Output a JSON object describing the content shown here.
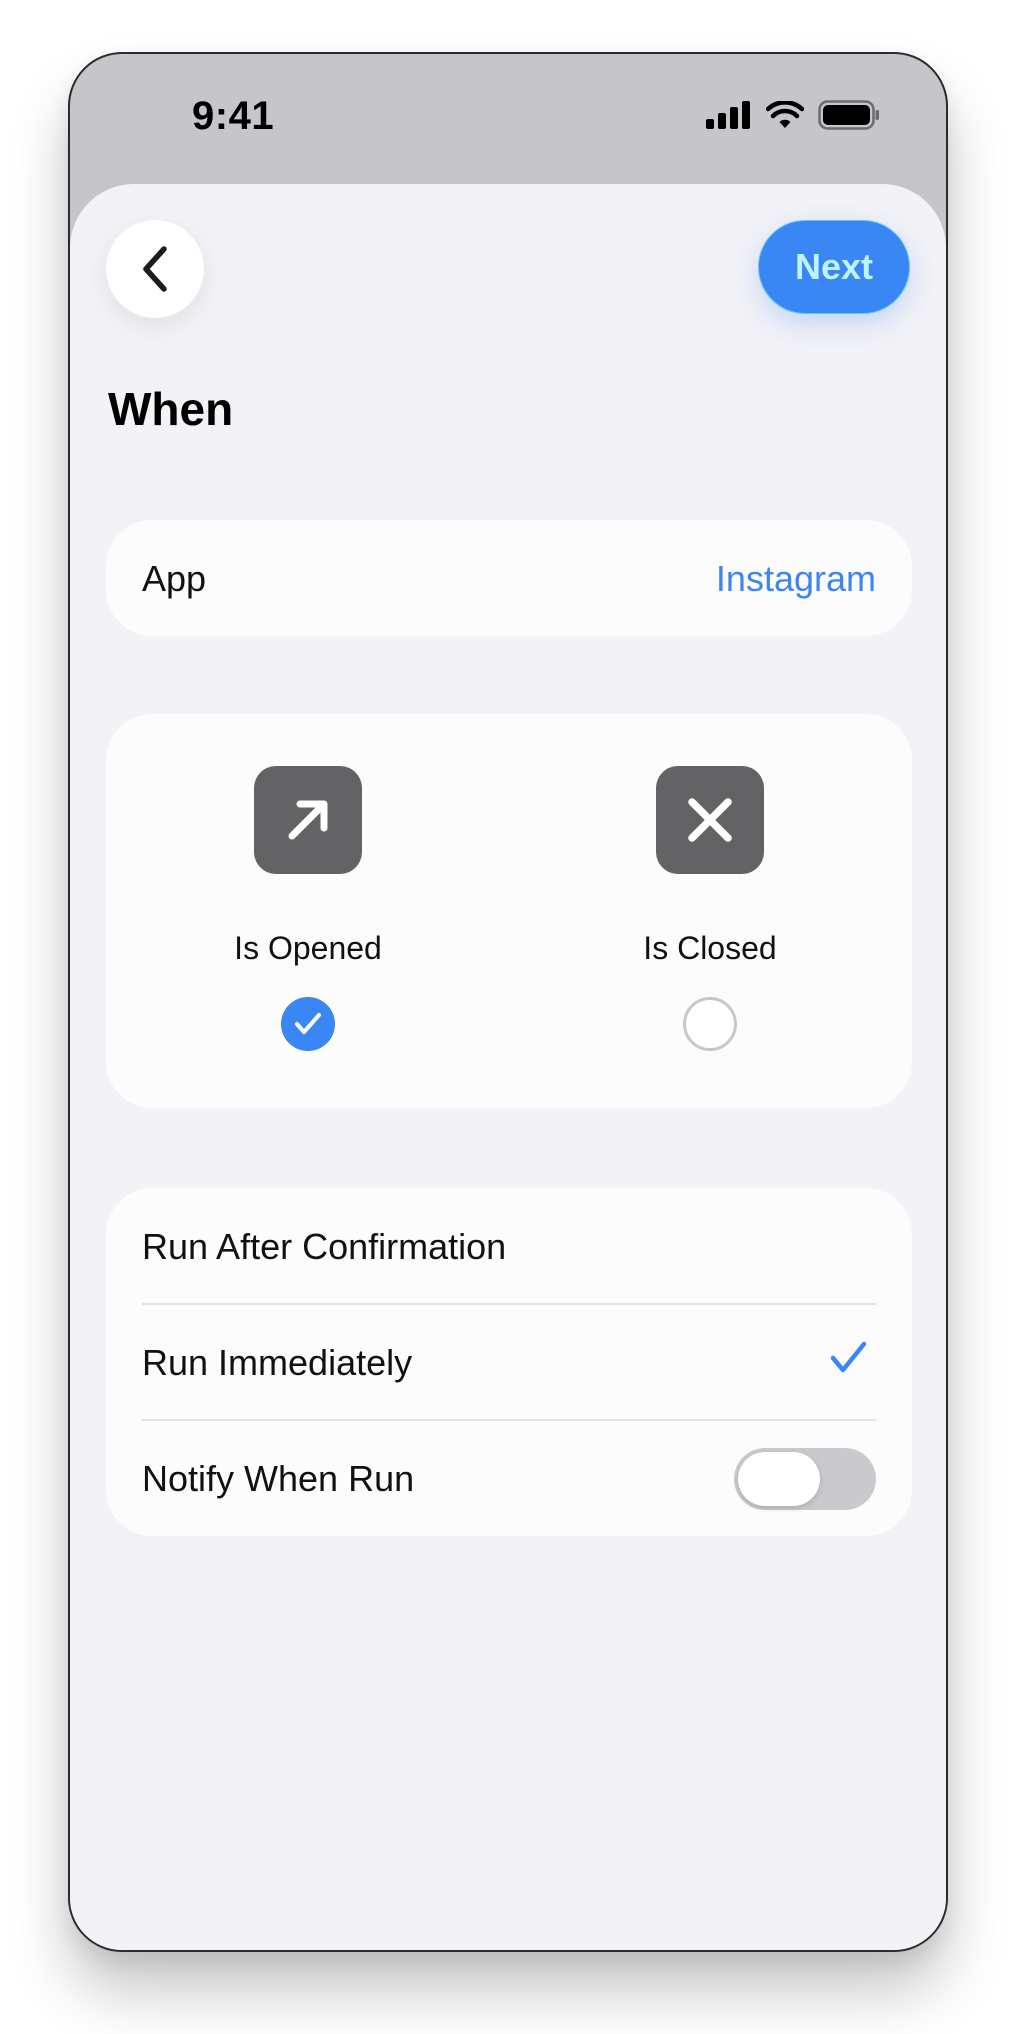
{
  "status_bar": {
    "time": "9:41",
    "icons": [
      "cellular-signal-icon",
      "wifi-icon",
      "battery-icon"
    ]
  },
  "nav": {
    "back_icon": "chevron-left-icon",
    "next_label": "Next"
  },
  "section_title": "When",
  "app_row": {
    "label": "App",
    "value": "Instagram"
  },
  "trigger_choices": [
    {
      "label": "Is Opened",
      "icon": "arrow-up-right-icon",
      "selected": true
    },
    {
      "label": "Is Closed",
      "icon": "xmark-icon",
      "selected": false
    }
  ],
  "run_options": [
    {
      "label": "Run After Confirmation",
      "checked": false
    },
    {
      "label": "Run Immediately",
      "checked": true
    }
  ],
  "notify": {
    "label": "Notify When Run",
    "enabled": false
  },
  "colors": {
    "accent": "#3a86f5",
    "sheet_bg": "#f2f2f7",
    "tile_gray": "#636366",
    "toggle_off": "#c9c9ce"
  }
}
